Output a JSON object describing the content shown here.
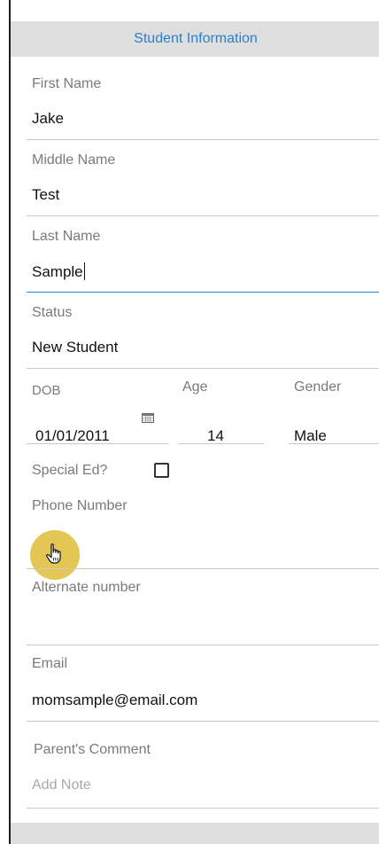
{
  "header": {
    "title": "Student Information"
  },
  "first_name": {
    "label": "First Name",
    "value": "Jake"
  },
  "middle_name": {
    "label": "Middle Name",
    "value": "Test"
  },
  "last_name": {
    "label": "Last Name",
    "value": "Sample"
  },
  "status": {
    "label": "Status",
    "value": "New Student"
  },
  "dob": {
    "label": "DOB",
    "value": "01/01/2011",
    "icon": "calendar-icon"
  },
  "age": {
    "label": "Age",
    "value": "14"
  },
  "gender": {
    "label": "Gender",
    "value": "Male"
  },
  "special_ed": {
    "label": "Special Ed?",
    "checked": false
  },
  "phone": {
    "label": "Phone Number",
    "value": ""
  },
  "alternate": {
    "label": "Alternate number",
    "value": ""
  },
  "email": {
    "label": "Email",
    "value": "momsample@email.com"
  },
  "comment": {
    "label": "Parent's Comment",
    "placeholder": "Add Note"
  },
  "colors": {
    "accent": "#2d7fcf",
    "header_bg": "#dedede",
    "cursor_highlight": "#e3c653"
  }
}
